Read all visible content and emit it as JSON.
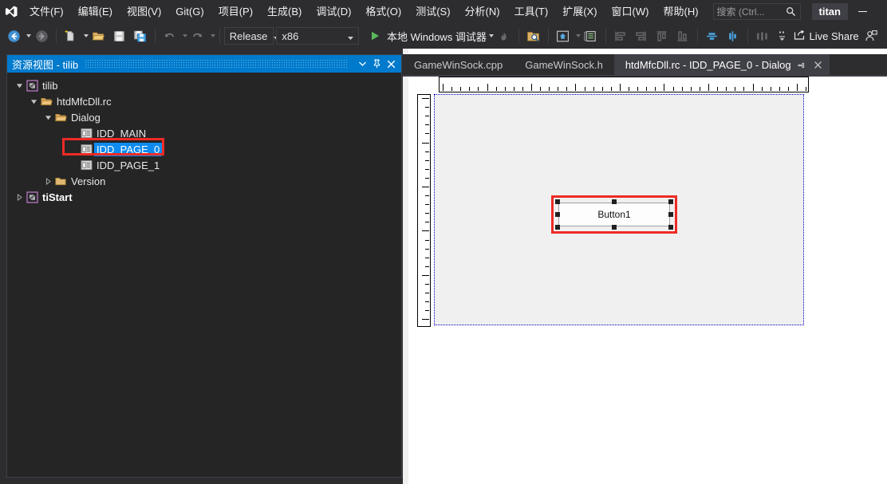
{
  "window": {
    "user_badge": "titan",
    "accent_blue": "#007acc",
    "selection_blue": "#0d8bf0",
    "annotation_red": "#ee2b24",
    "chrome_dark": "#2d2d30"
  },
  "menubar": {
    "logo_icon": "visual-studio-logo-icon",
    "items": [
      {
        "label": "文件(F)",
        "name": "menu-file"
      },
      {
        "label": "编辑(E)",
        "name": "menu-edit"
      },
      {
        "label": "视图(V)",
        "name": "menu-view"
      },
      {
        "label": "Git(G)",
        "name": "menu-git"
      },
      {
        "label": "项目(P)",
        "name": "menu-project"
      },
      {
        "label": "生成(B)",
        "name": "menu-build"
      },
      {
        "label": "调试(D)",
        "name": "menu-debug"
      },
      {
        "label": "格式(O)",
        "name": "menu-format"
      },
      {
        "label": "测试(S)",
        "name": "menu-test"
      },
      {
        "label": "分析(N)",
        "name": "menu-analyze"
      },
      {
        "label": "工具(T)",
        "name": "menu-tools"
      },
      {
        "label": "扩展(X)",
        "name": "menu-extensions"
      },
      {
        "label": "窗口(W)",
        "name": "menu-window"
      },
      {
        "label": "帮助(H)",
        "name": "menu-help"
      }
    ],
    "search_placeholder": "搜索 (Ctrl...",
    "search_icon": "search-icon",
    "minimize_icon": "minimize-icon"
  },
  "toolbar": {
    "nav_back_icon": "navigate-back-icon",
    "nav_forward_icon": "navigate-forward-icon",
    "new_item_icon": "new-file-icon",
    "open_icon": "open-folder-icon",
    "save_icon": "save-icon",
    "save_all_icon": "save-all-icon",
    "undo_icon": "undo-icon",
    "redo_icon": "redo-icon",
    "configuration": "Release",
    "platform": "x86",
    "run_label": "本地 Windows 调试器",
    "run_icon": "play-icon",
    "hot_reload_icon": "hot-reload-icon",
    "folder_search_icon": "folder-search-icon",
    "home_icon": "home-icon",
    "properties_icon": "properties-window-icon",
    "align_left_icon": "align-left-icon",
    "align_right_icon": "align-right-icon",
    "align_top_icon": "align-top-icon",
    "align_bottom_icon": "align-bottom-icon",
    "center_horizontal_icon": "center-horizontal-icon",
    "center_vertical_icon": "center-vertical-icon",
    "space_across_icon": "space-across-icon",
    "overflow_icon": "toolbar-overflow-icon",
    "live_share_label": "Live Share",
    "live_share_icon": "live-share-icon",
    "account_icon": "account-icon"
  },
  "resource_view": {
    "title": "资源视图 - tilib",
    "dropdown_icon": "chevron-down-icon",
    "pin_icon": "pin-icon",
    "close_icon": "close-icon",
    "tree": [
      {
        "label": "tilib",
        "icon": "project-icon",
        "indent": 0,
        "twisty": "expanded",
        "bold": false,
        "selected": false
      },
      {
        "label": "htdMfcDll.rc",
        "icon": "folder-open-icon",
        "indent": 1,
        "twisty": "expanded",
        "bold": false,
        "selected": false
      },
      {
        "label": "Dialog",
        "icon": "folder-open-icon",
        "indent": 2,
        "twisty": "expanded",
        "bold": false,
        "selected": false
      },
      {
        "label": "IDD_MAIN",
        "icon": "dialog-resource-icon",
        "indent": 3,
        "twisty": "none",
        "bold": false,
        "selected": false
      },
      {
        "label": "IDD_PAGE_0",
        "icon": "dialog-resource-icon",
        "indent": 3,
        "twisty": "none",
        "bold": false,
        "selected": true
      },
      {
        "label": "IDD_PAGE_1",
        "icon": "dialog-resource-icon",
        "indent": 3,
        "twisty": "none",
        "bold": false,
        "selected": false
      },
      {
        "label": "Version",
        "icon": "folder-icon",
        "indent": 2,
        "twisty": "collapsed",
        "bold": false,
        "selected": false
      },
      {
        "label": "tiStart",
        "icon": "project-icon",
        "indent": 0,
        "twisty": "collapsed",
        "bold": true,
        "selected": false
      }
    ]
  },
  "editor": {
    "tabs": [
      {
        "label": "GameWinSock.cpp",
        "active": false
      },
      {
        "label": "GameWinSock.h",
        "active": false
      },
      {
        "label": "htdMfcDll.rc - IDD_PAGE_0 - Dialog",
        "active": true
      }
    ],
    "tab_pin_icon": "pin-icon",
    "tab_close_icon": "close-icon",
    "designer": {
      "button_label": "Button1",
      "horizontal_ruler": "horizontal-ruler",
      "vertical_ruler": "vertical-ruler"
    }
  }
}
